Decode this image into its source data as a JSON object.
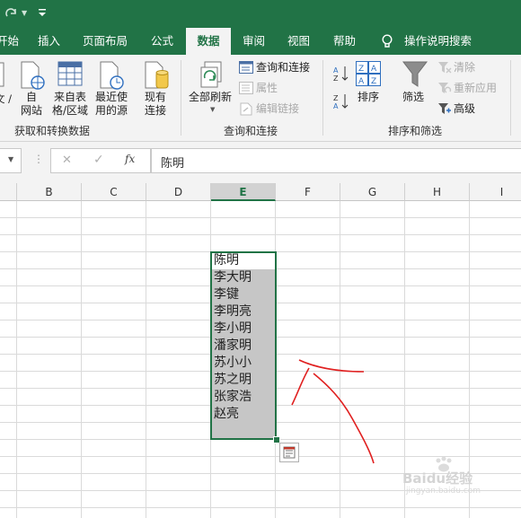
{
  "app": {
    "accent_color": "#217346"
  },
  "quick_access": {
    "redo_icon": "redo-icon",
    "dropdown_icon": "customize-quick-access-icon"
  },
  "tabs": [
    {
      "label": "开始"
    },
    {
      "label": "插入"
    },
    {
      "label": "页面布局"
    },
    {
      "label": "公式"
    },
    {
      "label": "数据"
    },
    {
      "label": "审阅"
    },
    {
      "label": "视图"
    },
    {
      "label": "帮助"
    }
  ],
  "tell_me": {
    "icon": "lightbulb-icon",
    "label": "操作说明搜索"
  },
  "ribbon": {
    "get_transform": {
      "from_csv_label": "从文本/CSV",
      "from_csv_clip": "文 / CSV",
      "from_web_label_1": "自",
      "from_web_label_2": "网站",
      "from_table_label_1": "来自表",
      "from_table_label_2": "格/区域",
      "recent_sources_label_1": "最近使",
      "recent_sources_label_2": "用的源",
      "existing_conn_label_1": "现有",
      "existing_conn_label_2": "连接",
      "group_label": "获取和转换数据"
    },
    "queries": {
      "refresh_all_label": "全部刷新",
      "queries_connections_label": "查询和连接",
      "properties_label": "属性",
      "edit_links_label": "编辑链接",
      "group_label": "查询和连接"
    },
    "sort_filter": {
      "sort_label": "排序",
      "filter_label": "筛选",
      "clear_label": "清除",
      "reapply_label": "重新应用",
      "advanced_label": "高级",
      "group_label": "排序和筛选"
    }
  },
  "formula_bar": {
    "cancel": "✕",
    "enter": "✓",
    "fx": "fx",
    "value": "陈明"
  },
  "sheet": {
    "columns": [
      "B",
      "C",
      "D",
      "E",
      "F",
      "G",
      "H",
      "I"
    ],
    "selected_column": "E",
    "cells": [
      "陈明",
      "李大明",
      "李键",
      "李明亮",
      "李小明",
      "潘家明",
      "苏小小",
      "苏之明",
      "张家浩",
      "赵亮"
    ]
  },
  "watermark": {
    "text": "Baidu经验",
    "subtext": "jingyan.baidu.com"
  }
}
